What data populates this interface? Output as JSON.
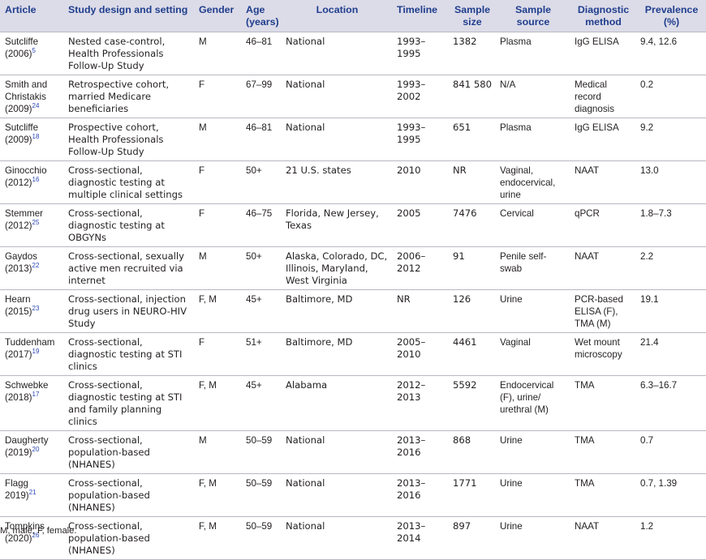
{
  "headers": {
    "article": "Article",
    "design": "Study design and setting",
    "gender": "Gender",
    "age_1": "Age",
    "age_2": "(years)",
    "location": "Location",
    "timeline": "Timeline",
    "sample_size_1": "Sample",
    "sample_size_2": "size",
    "sample_source_1": "Sample",
    "sample_source_2": "source",
    "diagnostic_1": "Diagnostic",
    "diagnostic_2": "method",
    "prevalence_1": "Prevalence",
    "prevalence_2": "(%)"
  },
  "rows": [
    {
      "author": "Sutcliffe",
      "year": "(2006)",
      "ref": "5",
      "design": "Nested case-control, Health Professionals Follow-Up Study",
      "gender": "M",
      "age": "46–81",
      "location": "National",
      "timeline": "1993–1995",
      "sample_size": "1382",
      "sample_source": "Plasma",
      "diagnostic": "IgG ELISA",
      "prevalence": "9.4, 12.6"
    },
    {
      "author": "Smith and Christakis",
      "year": "(2009)",
      "ref": "24",
      "design": "Retrospective cohort, married Medicare beneficiaries",
      "gender": "F",
      "age": "67–99",
      "location": "National",
      "timeline": "1993–2002",
      "sample_size": "841 580",
      "sample_source": "N/A",
      "diagnostic": "Medical record diagnosis",
      "prevalence": "0.2"
    },
    {
      "author": "Sutcliffe",
      "year": "(2009)",
      "ref": "18",
      "design": "Prospective cohort, Health Professionals Follow-Up Study",
      "gender": "M",
      "age": "46–81",
      "location": "National",
      "timeline": "1993–1995",
      "sample_size": "651",
      "sample_source": "Plasma",
      "diagnostic": "IgG ELISA",
      "prevalence": "9.2"
    },
    {
      "author": "Ginocchio",
      "year": "(2012)",
      "ref": "16",
      "design": "Cross-sectional, diagnostic testing at multiple clinical settings",
      "gender": "F",
      "age": "50+",
      "location": "21 U.S. states",
      "timeline": "2010",
      "sample_size": "NR",
      "sample_source": "Vaginal, endocervical, urine",
      "diagnostic": "NAAT",
      "prevalence": "13.0"
    },
    {
      "author": "Stemmer",
      "year": "(2012)",
      "ref": "25",
      "design": "Cross-sectional, diagnostic testing at OBGYNs",
      "gender": "F",
      "age": "46–75",
      "location": "Florida, New Jersey, Texas",
      "timeline": "2005",
      "sample_size": "7476",
      "sample_source": "Cervical",
      "diagnostic": "qPCR",
      "prevalence": "1.8–7.3"
    },
    {
      "author": "Gaydos",
      "year": "(2013)",
      "ref": "22",
      "design": "Cross-sectional, sexually active men recruited via internet",
      "gender": "M",
      "age": "50+",
      "location": "Alaska, Colorado, DC, Illinois, Maryland, West Virginia",
      "timeline": "2006–2012",
      "sample_size": "91",
      "sample_source": "Penile self-swab",
      "diagnostic": "NAAT",
      "prevalence": "2.2"
    },
    {
      "author": "Hearn",
      "year": "(2015)",
      "ref": "23",
      "design": "Cross-sectional, injection drug users in NEURO-HIV Study",
      "gender": "F, M",
      "age": "45+",
      "location": "Baltimore, MD",
      "timeline": "NR",
      "sample_size": "126",
      "sample_source": "Urine",
      "diagnostic": "PCR-based ELISA (F), TMA (M)",
      "prevalence": "19.1"
    },
    {
      "author": "Tuddenham",
      "year": "(2017)",
      "ref": "19",
      "design": "Cross-sectional, diagnostic testing at STI clinics",
      "gender": "F",
      "age": "51+",
      "location": "Baltimore, MD",
      "timeline": "2005–2010",
      "sample_size": "4461",
      "sample_source": "Vaginal",
      "diagnostic": "Wet mount microscopy",
      "prevalence": "21.4"
    },
    {
      "author": "Schwebke",
      "year": "(2018)",
      "ref": "17",
      "design": "Cross-sectional, diagnostic testing at STI and family planning clinics",
      "gender": "F, M",
      "age": "45+",
      "location": "Alabama",
      "timeline": "2012–2013",
      "sample_size": "5592",
      "sample_source": "Endocervical (F), urine/ urethral (M)",
      "diagnostic": "TMA",
      "prevalence": "6.3–16.7"
    },
    {
      "author": "Daugherty",
      "year": "(2019)",
      "ref": "20",
      "design": "Cross-sectional, population-based (NHANES)",
      "gender": "M",
      "age": "50–59",
      "location": "National",
      "timeline": "2013–2016",
      "sample_size": "868",
      "sample_source": "Urine",
      "diagnostic": "TMA",
      "prevalence": "0.7"
    },
    {
      "author": "Flagg",
      "year": "2019)",
      "ref": "21",
      "design": "Cross-sectional, population-based (NHANES)",
      "gender": "F, M",
      "age": "50–59",
      "location": "National",
      "timeline": "2013–2016",
      "sample_size": "1771",
      "sample_source": "Urine",
      "diagnostic": "TMA",
      "prevalence": "0.7, 1.39"
    },
    {
      "author": "Tompkins",
      "year": "(2020)",
      "ref": "26",
      "design": "Cross-sectional, population-based (NHANES)",
      "gender": "F, M",
      "age": "50–59",
      "location": "National",
      "timeline": "2013–2014",
      "sample_size": "897",
      "sample_source": "Urine",
      "diagnostic": "NAAT",
      "prevalence": "1.2"
    }
  ],
  "footnote": "M, male; F, female."
}
